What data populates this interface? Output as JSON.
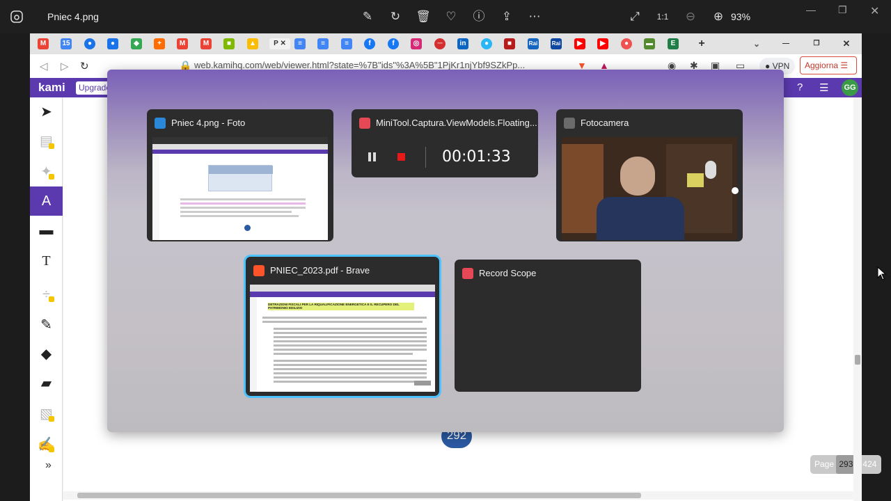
{
  "photos_app": {
    "title": "Pniec 4.png",
    "zoom": "93%"
  },
  "browser": {
    "url": "web.kamihq.com/web/viewer.html?state=%7B\"ids\"%3A%5B\"1PjKr1njYbf9SZkPp...",
    "vpn_label": "VPN",
    "update_button": "Aggiorna"
  },
  "kami": {
    "logo": "kami",
    "upgrade_label": "Upgrade",
    "avatar_initials": "GG"
  },
  "document": {
    "page_number_badge": "292",
    "pager": {
      "label": "Page",
      "current": "293",
      "total": "/ 424"
    }
  },
  "task_switcher": {
    "windows": [
      {
        "title": "Pniec 4.png - Foto",
        "icon": "photos-icon",
        "color": "#2b88d8"
      },
      {
        "title": "MiniTool.Captura.ViewModels.Floating...",
        "icon": "record-icon",
        "color": "#e74856"
      },
      {
        "title": "Fotocamera",
        "icon": "camera-icon",
        "color": "#6b6b6b"
      },
      {
        "title": "PNIEC_2023.pdf - Brave",
        "icon": "brave-icon",
        "color": "#fb542b"
      },
      {
        "title": "Record Scope",
        "icon": "record-icon",
        "color": "#e74856"
      }
    ],
    "recorder_time": "00:01:33",
    "pdf_heading": "DETRAZIONI FISCALI PER LA RIQUALIFICAZIONE ENERGETICA E IL RECUPERO DEL PATRIMONIO EDILIZIO",
    "foto_table": {
      "header_left": "Tipologia di destinatario dell'abitazione",
      "header_right": "% sui famiglie in povertà",
      "rows": [
        [
          "Affitto",
          "40%"
        ],
        [
          "Proprietà",
          "41%"
        ],
        [
          "Usufrutto o uso gratuito",
          "19%"
        ]
      ]
    }
  },
  "colors": {
    "kami_purple": "#5b3ab0",
    "selection": "#4cc2ff",
    "page_badge": "#2b5aa3"
  }
}
